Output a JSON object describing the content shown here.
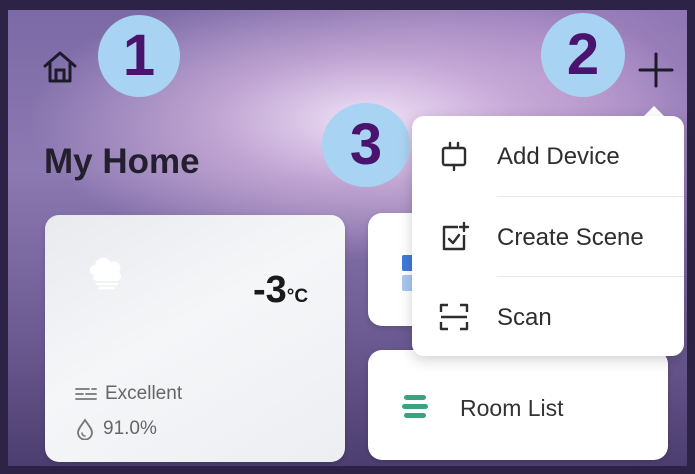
{
  "badges": {
    "one": "1",
    "two": "2",
    "three": "3"
  },
  "header": {
    "title": "My Home"
  },
  "weather": {
    "temperature": "-3",
    "unit": "°C",
    "air_quality": "Excellent",
    "humidity": "91.0%"
  },
  "room_card": {
    "label": "Room List"
  },
  "menu": {
    "items": [
      {
        "label": "Add Device",
        "icon": "add-device-icon"
      },
      {
        "label": "Create Scene",
        "icon": "create-scene-icon"
      },
      {
        "label": "Scan",
        "icon": "scan-icon"
      }
    ]
  },
  "colors": {
    "badge_bg": "#a9d3f2",
    "badge_text": "#4a136e",
    "accent_green": "#3aa37e",
    "accent_blue": "#3f7bd8"
  }
}
